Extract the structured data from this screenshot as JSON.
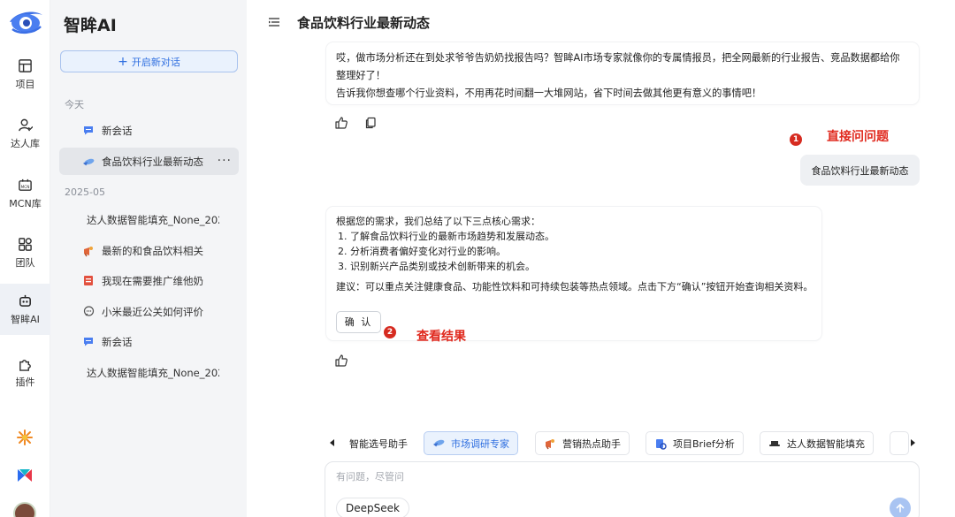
{
  "rail": {
    "items": [
      {
        "label": "项目",
        "icon": "project-icon"
      },
      {
        "label": "达人库",
        "icon": "user-icon"
      },
      {
        "label": "MCN库",
        "icon": "mcn-icon"
      },
      {
        "label": "团队",
        "icon": "team-icon"
      },
      {
        "label": "智眸AI",
        "icon": "robot-icon"
      },
      {
        "label": "插件",
        "icon": "plugin-icon"
      }
    ],
    "extra_icons": [
      "spark-app-icon",
      "colorful-app-icon",
      "avatar"
    ]
  },
  "sidebar": {
    "brand": "智眸AI",
    "new_chat": "开启新对话",
    "groups": [
      {
        "label": "今天",
        "sessions": [
          {
            "title": "新会话",
            "icon": "chat-bubble-icon"
          },
          {
            "title": "食品饮料行业最新动态",
            "icon": "research-icon",
            "active": true
          }
        ]
      },
      {
        "label": "2025-05",
        "sessions": [
          {
            "title": "达人数据智能填充_None_202",
            "icon": ""
          },
          {
            "title": "最新的和食品饮料相关",
            "icon": "marketing-icon"
          },
          {
            "title": "我现在需要推广维他奶",
            "icon": "brief-icon"
          },
          {
            "title": "小米最近公关如何评价",
            "icon": "comment-icon"
          },
          {
            "title": "新会话",
            "icon": "chat-bubble-icon"
          },
          {
            "title": "达人数据智能填充_None_202",
            "icon": ""
          }
        ]
      }
    ]
  },
  "main": {
    "title": "食品饮料行业最新动态",
    "intro": {
      "line1": "哎，做市场分析还在到处求爷爷告奶奶找报告吗？智眸AI市场专家就像你的专属情报员，把全网最新的行业报告、竞品数据都给你整理好了！",
      "line2": "告诉我你想查哪个行业资料，不用再花时间翻一大堆网站，省下时间去做其他更有意义的事情吧！"
    },
    "annotation1": {
      "num": "1",
      "text": "直接问问题"
    },
    "user_message": "食品饮料行业最新动态",
    "reply": {
      "intro": "根据您的需求，我们总结了以下三点核心需求：",
      "points": [
        "1. 了解食品饮料行业的最新市场趋势和发展动态。",
        "2. 分析消费者偏好变化对行业的影响。",
        "3. 识别新兴产品类别或技术创新带来的机会。"
      ],
      "suggestion": "建议：可以重点关注健康食品、功能性饮料和可持续包装等热点领域。点击下方“确认”按钮开始查询相关资料。",
      "confirm": "确 认"
    },
    "annotation2": {
      "num": "2",
      "text": "查看结果"
    }
  },
  "tools": [
    {
      "label": "智能选号助手",
      "icon": ""
    },
    {
      "label": "市场调研专家",
      "icon": "research-icon",
      "active": true
    },
    {
      "label": "营销热点助手",
      "icon": "marketing-icon"
    },
    {
      "label": "项目Brief分析",
      "icon": "brief-icon"
    },
    {
      "label": "达人数据智能填充",
      "icon": "hat-icon"
    }
  ],
  "input": {
    "placeholder": "有问题，尽管问",
    "model": "DeepSeek"
  },
  "colors": {
    "accent": "#2f6fe0",
    "annotation": "#e02a1f",
    "sidebar_bg": "#f4f5f7"
  }
}
